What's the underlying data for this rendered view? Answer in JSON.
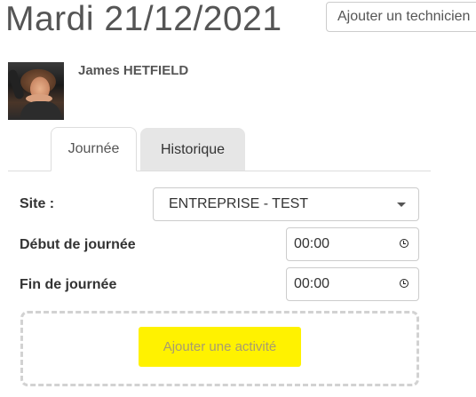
{
  "header": {
    "date_title": "Mardi 21/12/2021",
    "add_technician_placeholder": "Ajouter un technicien"
  },
  "technician": {
    "name": "James HETFIELD"
  },
  "tabs": [
    {
      "label": "Journée",
      "active": true
    },
    {
      "label": "Historique",
      "active": false
    }
  ],
  "form": {
    "site_label": "Site :",
    "site_value": "ENTREPRISE - TEST",
    "start_label": "Début de journée",
    "start_value": "00:00",
    "end_label": "Fin de journée",
    "end_value": "00:00"
  },
  "activity": {
    "add_label": "Ajouter une activité"
  },
  "icons": {
    "select_caret": "chevron-down-icon",
    "time_picker": "clock-icon"
  },
  "colors": {
    "highlight": "#fff200",
    "inactive_tab": "#e6e6e6",
    "dashed_border": "#d2d2d2"
  }
}
